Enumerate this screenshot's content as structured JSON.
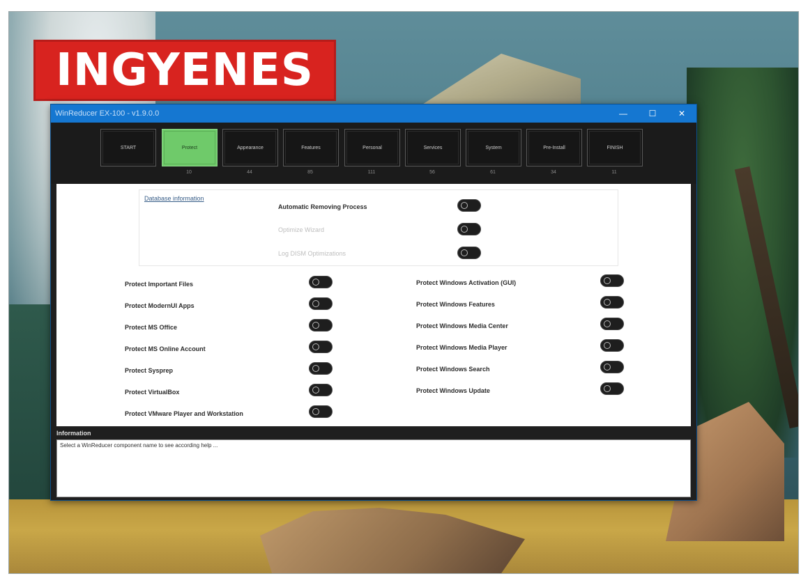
{
  "headline": "INGYENES",
  "window": {
    "title": "WinReducer EX-100 - v1.9.0.0",
    "controls": {
      "minimize": "—",
      "maximize": "☐",
      "close": "✕"
    }
  },
  "tabs": [
    {
      "label": "START",
      "count": ""
    },
    {
      "label": "Protect",
      "count": "10"
    },
    {
      "label": "Appearance",
      "count": "44"
    },
    {
      "label": "Features",
      "count": "85"
    },
    {
      "label": "Personal",
      "count": "111"
    },
    {
      "label": "Services",
      "count": "56"
    },
    {
      "label": "System",
      "count": "61"
    },
    {
      "label": "Pre-Install",
      "count": "34"
    },
    {
      "label": "FINISH",
      "count": "11"
    }
  ],
  "active_tab": "Protect",
  "database": {
    "link": "Database information",
    "options": [
      {
        "label": "Automatic Removing Process",
        "enabled": true,
        "on": false
      },
      {
        "label": "Optimize Wizard",
        "enabled": false,
        "on": false
      },
      {
        "label": "Log DISM Optimizations",
        "enabled": false,
        "on": false
      }
    ]
  },
  "protect_left": [
    "Protect Important Files",
    "Protect ModernUI Apps",
    "Protect MS Office",
    "Protect MS Online Account",
    "Protect Sysprep",
    "Protect VirtualBox",
    "Protect VMware Player and Workstation"
  ],
  "protect_right": [
    "Protect Windows Activation (GUI)",
    "Protect Windows Features",
    "Protect Windows Media Center",
    "Protect Windows Media Player",
    "Protect Windows Search",
    "Protect Windows Update"
  ],
  "information": {
    "title": "Information",
    "text": "Select a WinReducer component name to see according help ..."
  },
  "colors": {
    "headline_bg": "#d8231f",
    "titlebar": "#1577d1",
    "active_tab": "#6fca6a",
    "window_bg": "#1f1f1f"
  }
}
